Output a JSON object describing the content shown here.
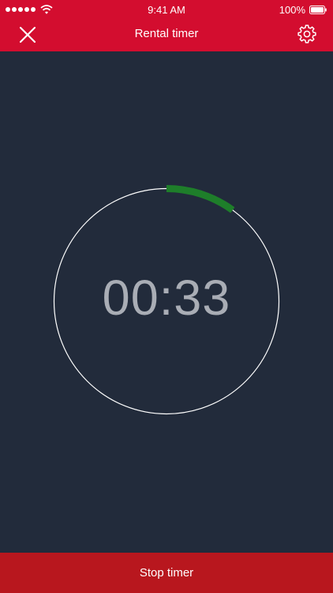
{
  "status_bar": {
    "time": "9:41 AM",
    "battery_percent": "100%",
    "signal_icon": "signal-dots-icon",
    "wifi_icon": "wifi-icon",
    "battery_icon": "battery-icon"
  },
  "header": {
    "title": "Rental timer",
    "close_icon": "close-icon",
    "settings_icon": "gear-icon",
    "background_color": "#d30d2f"
  },
  "timer": {
    "display": "00:33",
    "progress_fraction": 0.1,
    "progress_color": "#1e7e2a",
    "ring_color": "#ffffff"
  },
  "footer": {
    "stop_label": "Stop timer",
    "background_color": "#b8171e"
  },
  "colors": {
    "background": "#222b3b",
    "timer_text": "#a9adb5"
  }
}
